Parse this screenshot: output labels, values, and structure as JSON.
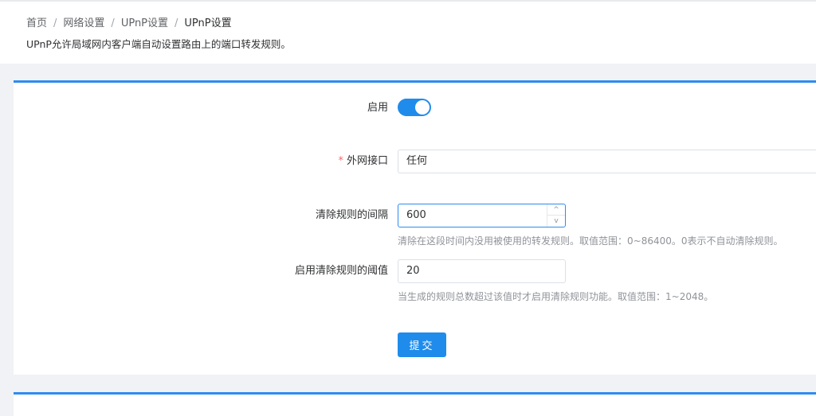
{
  "breadcrumb": {
    "items": [
      "首页",
      "网络设置",
      "UPnP设置",
      "UPnP设置"
    ],
    "separator": "/"
  },
  "subtitle": "UPnP允许局域网内客户端自动设置路由上的端口转发规则。",
  "form": {
    "enable": {
      "label": "启用",
      "value": true
    },
    "wan_interface": {
      "required_mark": "*",
      "label": "外网接口",
      "value": "任何"
    },
    "clean_interval": {
      "label": "清除规则的间隔",
      "value": "600",
      "up_icon": "^",
      "down_icon": "v",
      "hint": "清除在这段时间内没用被使用的转发规则。取值范围：0~86400。0表示不自动清除规则。"
    },
    "clean_threshold": {
      "label": "启用清除规则的阈值",
      "value": "20",
      "hint": "当生成的规则总数超过该值时才启用清除规则功能。取值范围：1~2048。"
    },
    "submit_label": "提交"
  },
  "colors": {
    "accent": "#1f8ceb",
    "card_border": "#2d8cf0",
    "required": "#f56c6c"
  }
}
